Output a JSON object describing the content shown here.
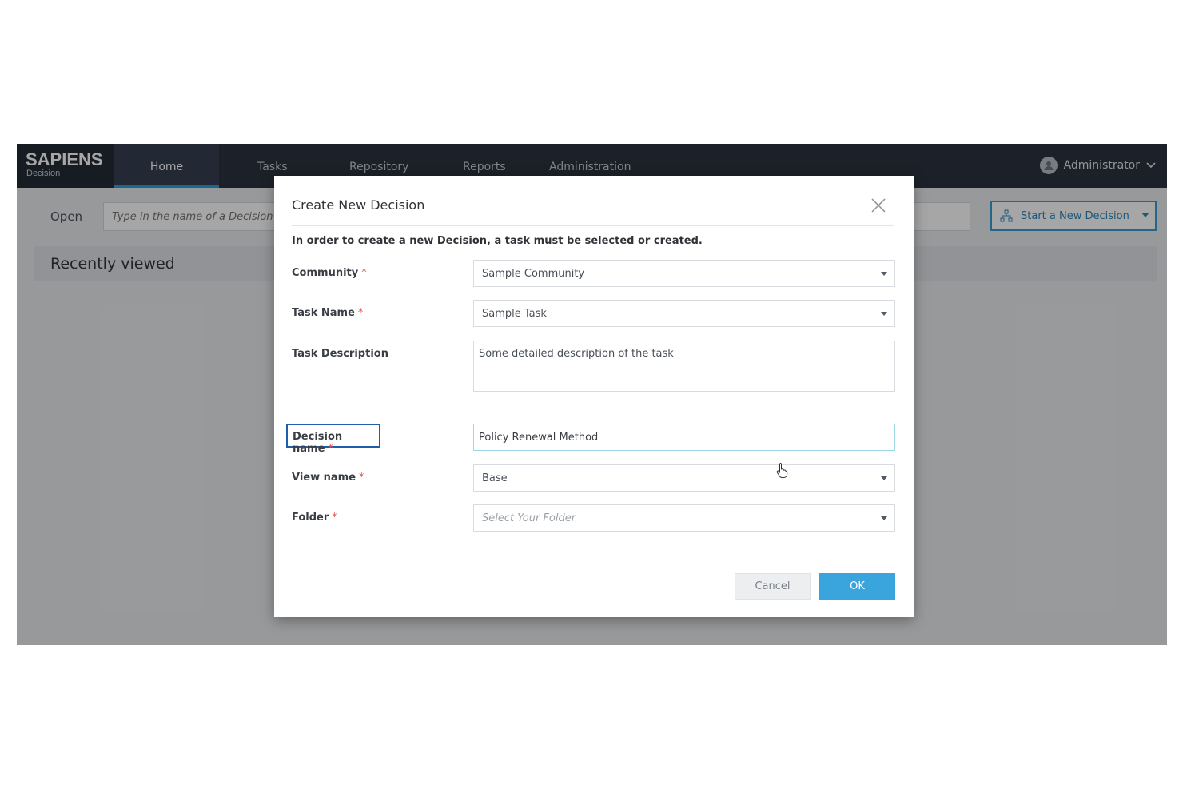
{
  "brand": {
    "name": "SAPIENS",
    "product": "Decision"
  },
  "nav": {
    "items": [
      {
        "label": "Home",
        "active": true
      },
      {
        "label": "Tasks",
        "active": false
      },
      {
        "label": "Repository",
        "active": false
      },
      {
        "label": "Reports",
        "active": false
      },
      {
        "label": "Administration",
        "active": false
      }
    ],
    "user": {
      "name": "Administrator",
      "icon": "user-avatar-icon"
    }
  },
  "toolbar": {
    "open_label": "Open",
    "search_placeholder": "Type in the name of a Decision or",
    "start_button_label": "Start a New Decision"
  },
  "recent": {
    "title": "Recently viewed"
  },
  "modal": {
    "title": "Create New Decision",
    "instruction": "In order to create a new Decision, a task must be selected or created.",
    "fields": {
      "community": {
        "label": "Community",
        "required_mark": "*",
        "value": "Sample Community"
      },
      "task_name": {
        "label": "Task Name",
        "required_mark": "*",
        "value": "Sample Task"
      },
      "task_description": {
        "label": "Task Description",
        "value": "Some detailed description of the task"
      },
      "decision_name": {
        "label": "Decision name",
        "required_mark": "*",
        "value": "Policy Renewal Method"
      },
      "view_name": {
        "label": "View name",
        "required_mark": "*",
        "value": "Base"
      },
      "folder": {
        "label": "Folder",
        "required_mark": "*",
        "placeholder": "Select Your Folder"
      }
    },
    "buttons": {
      "cancel": "Cancel",
      "ok": "OK"
    }
  },
  "colors": {
    "nav_bg": "#2b3440",
    "accent": "#3aa4dc",
    "required": "#e0524a",
    "focus_border": "#1f5ea8"
  }
}
